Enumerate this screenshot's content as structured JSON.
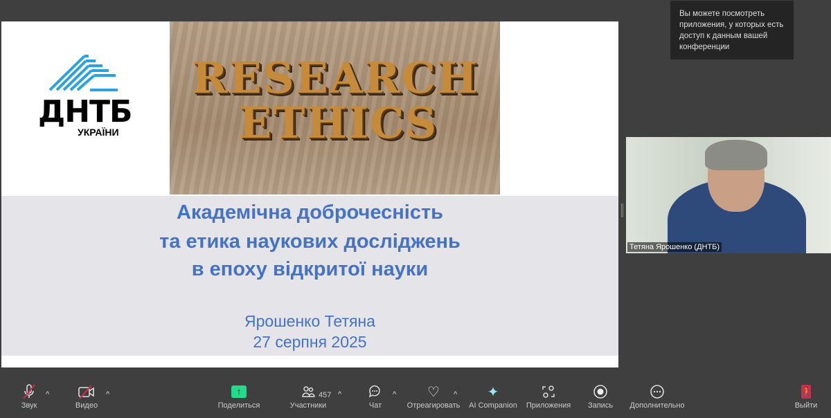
{
  "slide": {
    "logo_main": "ДНТБ",
    "logo_sub": "УКРАЇНИ",
    "photo_word1": "RESEARCH",
    "photo_word2": "ETHICS",
    "title_lines": [
      "Академічна доброчесність",
      "та етика наукових досліджень",
      "в епоху відкритої науки"
    ],
    "author": "Ярошенко Тетяна",
    "date": "27 серпня 2025"
  },
  "tooltip": "Вы можете посмотреть приложения, у которых есть доступ к данным вашей конференции",
  "video": {
    "participant_name": "Тетяна Ярошенко (ДНТБ)"
  },
  "toolbar": {
    "audio": "Звук",
    "video": "Видео",
    "share": "Поделиться",
    "participants": "Участники",
    "participants_count": "457",
    "chat": "Чат",
    "react": "Отреагировать",
    "ai": "AI Companion",
    "apps": "Приложения",
    "record": "Запись",
    "more": "Дополнительно",
    "leave": "Выйти"
  },
  "colors": {
    "accent": "#4472c4",
    "share": "#23d98a",
    "leave": "#c4314b"
  }
}
